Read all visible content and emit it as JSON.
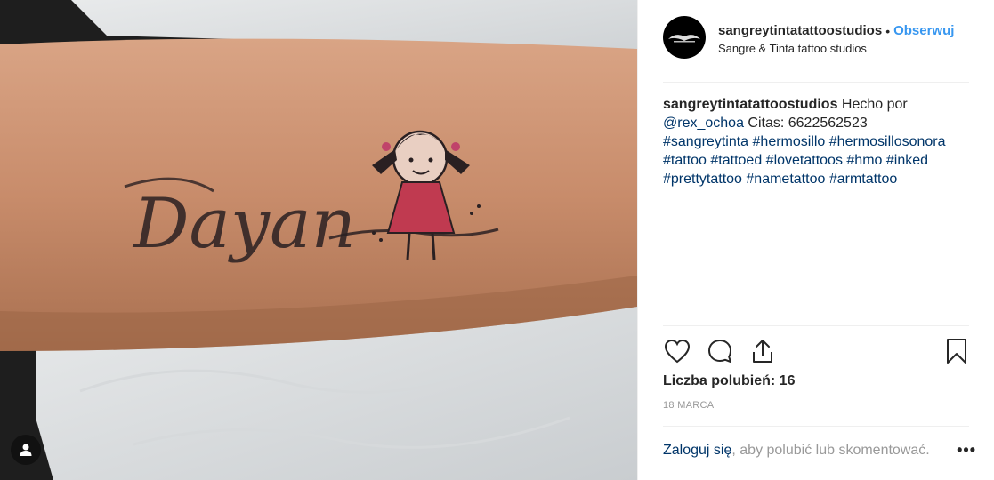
{
  "post": {
    "username": "sangreytintatattoostudios",
    "follow_separator": "•",
    "follow_label": "Obserwuj",
    "location": "Sangre & Tinta tattoo studios"
  },
  "photo": {
    "tattoo_text": "Dayan"
  },
  "caption": {
    "username": "sangreytintatattoostudios",
    "text_1": " Hecho por ",
    "mention": "@rex_ochoa",
    "text_2": " Citas: 6622562523",
    "hashtags": [
      "#sangreytinta",
      "#hermosillo",
      "#hermosillosonora",
      "#tattoo",
      "#tattoed",
      "#lovetattoos",
      "#hmo",
      "#inked",
      "#prettytattoo",
      "#nametattoo",
      "#armtattoo"
    ]
  },
  "actions": {
    "like": "heart-icon",
    "comment": "comment-icon",
    "share": "share-icon",
    "save": "bookmark-icon"
  },
  "likes_text": "Liczba polubień: 16",
  "date": "18 MARCA",
  "login": {
    "link": "Zaloguj się",
    "rest": ", aby polubić lub skomentować.",
    "more": "•••"
  },
  "colors": {
    "follow": "#3897f0",
    "link": "#003569",
    "muted": "#999999"
  }
}
